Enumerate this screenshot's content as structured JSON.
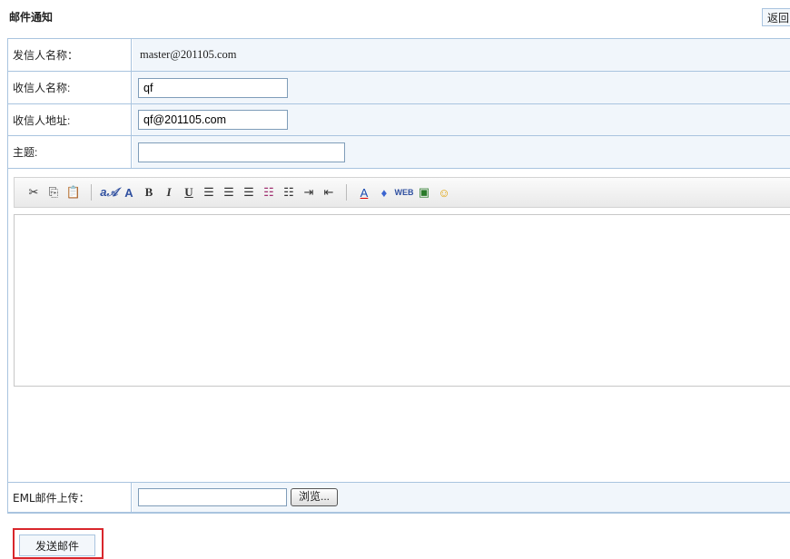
{
  "page": {
    "title": "邮件通知",
    "back_label": "返回"
  },
  "form": {
    "sender_label": "发信人名称：",
    "sender_value": "master@201105.com",
    "recipient_name_label": "收信人名称:",
    "recipient_name_value": "qf",
    "recipient_address_label": "收信人地址:",
    "recipient_address_value": "qf@201105.com",
    "subject_label": "主题:",
    "subject_value": "",
    "upload_label": "EML邮件上传：",
    "upload_value": "",
    "browse_label": "浏览..."
  },
  "toolbar": {
    "icons": [
      "cut-icon",
      "copy-icon",
      "paste-icon",
      "font-face-icon",
      "font-size-icon",
      "bold-icon",
      "italic-icon",
      "underline-icon",
      "align-left-icon",
      "align-center-icon",
      "align-right-icon",
      "ordered-list-icon",
      "unordered-list-icon",
      "indent-icon",
      "outdent-icon",
      "text-color-icon",
      "background-color-icon",
      "link-icon",
      "image-icon",
      "emoticon-icon"
    ]
  },
  "actions": {
    "send_label": "发送邮件"
  }
}
